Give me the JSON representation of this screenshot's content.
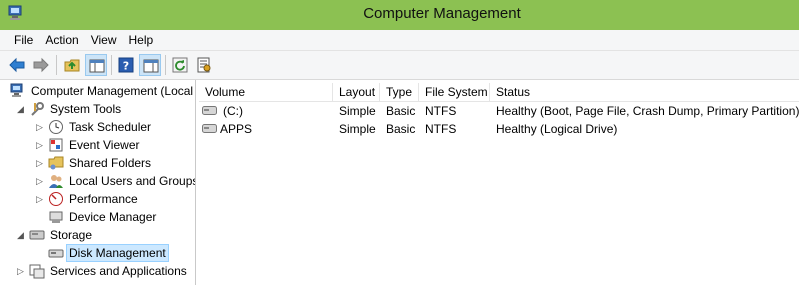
{
  "window": {
    "title": "Computer Management"
  },
  "menu": [
    "File",
    "Action",
    "View",
    "Help"
  ],
  "toolbar": [
    {
      "name": "back-button",
      "icon": "back-arrow-icon"
    },
    {
      "name": "forward-button",
      "icon": "forward-arrow-icon"
    },
    {
      "name": "up-one-level-button",
      "icon": "folder-up-icon"
    },
    {
      "name": "show-hide-console-tree-button",
      "icon": "console-tree-icon"
    },
    {
      "name": "help-button",
      "icon": "help-icon"
    },
    {
      "name": "show-hide-action-pane-button",
      "icon": "action-pane-icon"
    },
    {
      "name": "refresh-button",
      "icon": "refresh-icon"
    },
    {
      "name": "properties-button",
      "icon": "properties-icon"
    }
  ],
  "tree": {
    "root": "Computer Management (Local",
    "system_tools": "System Tools",
    "task_scheduler": "Task Scheduler",
    "event_viewer": "Event Viewer",
    "shared_folders": "Shared Folders",
    "local_users_groups": "Local Users and Groups",
    "performance": "Performance",
    "device_manager": "Device Manager",
    "storage": "Storage",
    "disk_management": "Disk Management",
    "services_applications": "Services and Applications"
  },
  "columns": [
    "Volume",
    "Layout",
    "Type",
    "File System",
    "Status"
  ],
  "volumes": [
    {
      "volume": "(C:)",
      "layout": "Simple",
      "type": "Basic",
      "fs": "NTFS",
      "status": "Healthy (Boot, Page File, Crash Dump, Primary Partition)"
    },
    {
      "volume": "APPS",
      "layout": "Simple",
      "type": "Basic",
      "fs": "NTFS",
      "status": "Healthy (Logical Drive)"
    }
  ],
  "colors": {
    "titlebar": "#8cc152",
    "selection": "#cce8ff"
  }
}
